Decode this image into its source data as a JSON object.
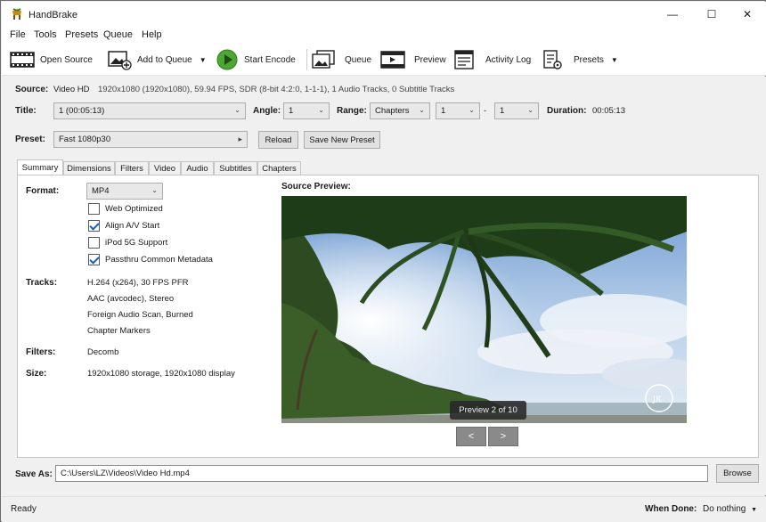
{
  "window": {
    "title": "HandBrake",
    "min": "—",
    "max": "☐",
    "close": "✕"
  },
  "menu": [
    "File",
    "Tools",
    "Presets",
    "Queue",
    "Help"
  ],
  "toolbar": {
    "open_source": "Open Source",
    "add_to_queue": "Add to Queue",
    "start_encode": "Start Encode",
    "queue": "Queue",
    "preview": "Preview",
    "activity_log": "Activity Log",
    "presets": "Presets"
  },
  "source": {
    "label": "Source:",
    "name": "Video HD",
    "details": "1920x1080 (1920x1080), 59.94 FPS, SDR (8-bit 4:2:0, 1-1-1), 1 Audio Tracks, 0 Subtitle Tracks"
  },
  "title_row": {
    "title_label": "Title:",
    "title_value": "1  (00:05:13)",
    "angle_label": "Angle:",
    "angle_value": "1",
    "range_label": "Range:",
    "range_type": "Chapters",
    "range_start": "1",
    "range_dash": "-",
    "range_end": "1",
    "duration_label": "Duration:",
    "duration_value": "00:05:13"
  },
  "preset": {
    "label": "Preset:",
    "value": "Fast 1080p30",
    "reload": "Reload",
    "save_new": "Save New Preset"
  },
  "tabs": [
    "Summary",
    "Dimensions",
    "Filters",
    "Video",
    "Audio",
    "Subtitles",
    "Chapters"
  ],
  "summary": {
    "format_label": "Format:",
    "format_value": "MP4",
    "options": [
      {
        "label": "Web Optimized",
        "checked": false
      },
      {
        "label": "Align A/V Start",
        "checked": true
      },
      {
        "label": "iPod 5G Support",
        "checked": false
      },
      {
        "label": "Passthru Common Metadata",
        "checked": true
      }
    ],
    "tracks_label": "Tracks:",
    "tracks": [
      "H.264 (x264), 30 FPS PFR",
      "AAC (avcodec), Stereo",
      "Foreign Audio Scan, Burned",
      "Chapter Markers"
    ],
    "filters_label": "Filters:",
    "filters_value": "Decomb",
    "size_label": "Size:",
    "size_value": "1920x1080 storage, 1920x1080 display",
    "source_preview_label": "Source Preview:",
    "preview_badge": "Preview 2 of 10",
    "prev": "<",
    "next": ">",
    "logo_text": "JK"
  },
  "save_as": {
    "label": "Save As:",
    "path": "C:\\Users\\LZ\\Videos\\Video Hd.mp4",
    "browse": "Browse"
  },
  "status": {
    "text": "Ready",
    "when_done_label": "When Done:",
    "when_done_value": "Do nothing"
  }
}
